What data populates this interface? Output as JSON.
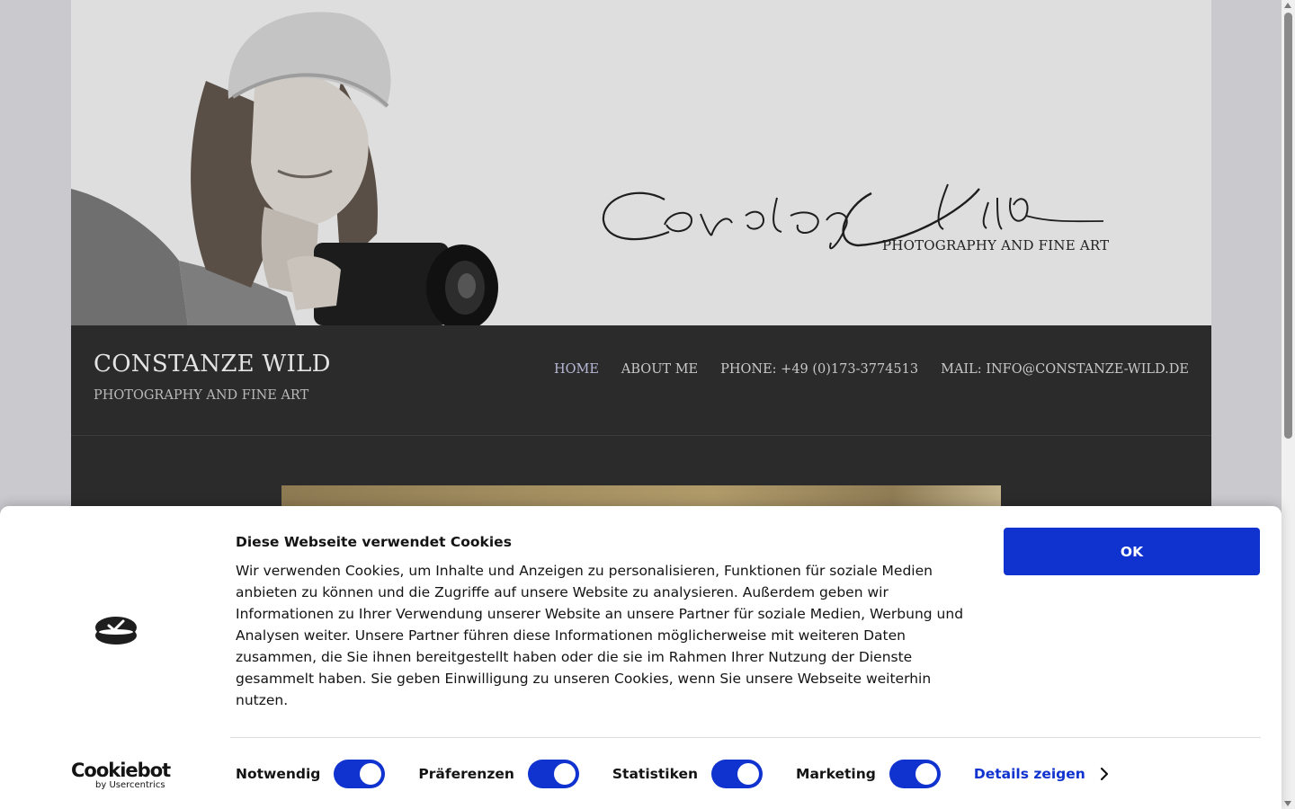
{
  "banner": {
    "signature": "Constanze Wild",
    "tagline": "PHOTOGRAPHY AND FINE ART"
  },
  "site": {
    "title": "CONSTANZE WILD",
    "description": "PHOTOGRAPHY AND FINE ART"
  },
  "nav": {
    "items": [
      {
        "label": "HOME",
        "active": true
      },
      {
        "label": "ABOUT ME"
      },
      {
        "label": "PHONE: +49 (0)173-3774513"
      },
      {
        "label": "MAIL: INFO@CONSTANZE-WILD.DE"
      }
    ]
  },
  "cookie": {
    "title": "Diese Webseite verwendet Cookies",
    "text": "Wir verwenden Cookies, um Inhalte und Anzeigen zu personalisieren, Funktionen für soziale Medien anbieten zu können und die Zugriffe auf unsere Website zu analysieren. Außerdem geben wir Informationen zu Ihrer Verwendung unserer Website an unsere Partner für soziale Medien, Werbung und Analysen weiter. Unsere Partner führen diese Informationen möglicherweise mit weiteren Daten zusammen, die Sie ihnen bereitgestellt haben oder die sie im Rahmen Ihrer Nutzung der Dienste gesammelt haben. Sie geben Einwilligung zu unseren Cookies, wenn Sie unsere Webseite weiterhin nutzen.",
    "ok_label": "OK",
    "brand": "Cookiebot",
    "brand_sub": "by Usercentrics",
    "toggles": [
      {
        "label": "Notwendig",
        "on": true
      },
      {
        "label": "Präferenzen",
        "on": true
      },
      {
        "label": "Statistiken",
        "on": true
      },
      {
        "label": "Marketing",
        "on": true
      }
    ],
    "details_label": "Details zeigen",
    "accent_color": "#1032cf"
  }
}
